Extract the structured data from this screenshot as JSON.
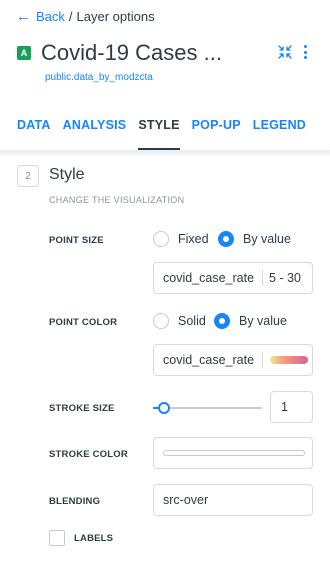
{
  "header": {
    "back_label": "Back",
    "breadcrumb_current": "Layer options",
    "layer_badge": "A",
    "layer_title": "Covid-19 Cases ...",
    "source_name": "public.data_by_modzcta"
  },
  "tabs": [
    {
      "label": "DATA",
      "active": false
    },
    {
      "label": "ANALYSIS",
      "active": false
    },
    {
      "label": "STYLE",
      "active": true
    },
    {
      "label": "POP-UP",
      "active": false
    },
    {
      "label": "LEGEND",
      "active": false
    }
  ],
  "section": {
    "number": "2",
    "title": "Style",
    "subtitle": "CHANGE THE VISUALIZATION"
  },
  "point_size": {
    "label": "POINT SIZE",
    "option_fixed": "Fixed",
    "option_by_value": "By value",
    "selected": "By value",
    "column": "covid_case_rate",
    "range": "5 - 30"
  },
  "point_color": {
    "label": "POINT COLOR",
    "option_solid": "Solid",
    "option_by_value": "By value",
    "selected": "By value",
    "column": "covid_case_rate"
  },
  "stroke_size": {
    "label": "STROKE SIZE",
    "value": "1"
  },
  "stroke_color": {
    "label": "STROKE COLOR",
    "color": "#ffffff"
  },
  "blending": {
    "label": "BLENDING",
    "value": "src-over"
  },
  "labels_toggle": {
    "label": "LABELS",
    "checked": false
  },
  "colors": {
    "accent": "#1785fb",
    "text": "#2e3c43",
    "badge": "#1b9e5a",
    "muted": "#8c9498"
  },
  "icons": {
    "back": "arrow-left-icon",
    "collapse": "collapse-arrows-icon",
    "more": "vertical-dots-icon"
  }
}
